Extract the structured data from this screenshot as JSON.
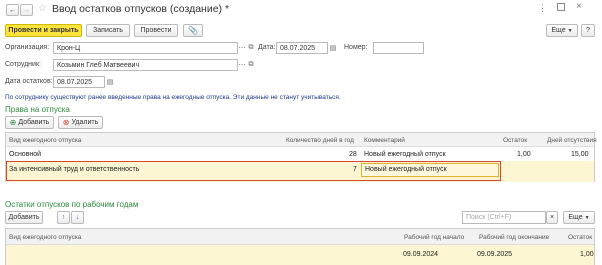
{
  "window": {
    "title": "Ввод остатков отпусков (создание) *",
    "more_icon": "more-icon",
    "maximize_icon": "maximize-icon",
    "close_icon": "close-icon"
  },
  "nav": {
    "back_icon": "arrow-left-icon",
    "forward_icon": "arrow-right-icon",
    "star_icon": "star-icon"
  },
  "toolbar": {
    "post_close": "Провести и закрыть",
    "save": "Записать",
    "post": "Провести",
    "attach_icon": "paperclip-icon",
    "more": "Еще",
    "help": "?"
  },
  "form": {
    "org_label": "Организация:",
    "org_value": "Крон-Ц",
    "date_label": "Дата:",
    "date_value": "08.07.2025",
    "number_label": "Номер:",
    "number_value": "",
    "employee_label": "Сотрудник:",
    "employee_value": "Козьмин Глеб Матвеевич",
    "balance_date_label": "Дата остатков:",
    "balance_date_value": "08.07.2025"
  },
  "notice": "По сотруднику существуют ранее введенные права на ежегодные отпуска. Эти данные не станут учитываться.",
  "rights": {
    "title": "Права на отпуска",
    "add": "Добавить",
    "delete": "Удалить",
    "columns": [
      "Вид ежегодного отпуска",
      "Количество дней в год",
      "Комментарий",
      "Остаток",
      "Дней отсутствия"
    ],
    "rows": [
      [
        "Основной",
        "28",
        "Новый ежегодный отпуск",
        "1,00",
        "15,00"
      ],
      [
        "За интенсивный труд и ответственность",
        "7",
        "Новый ежегодный отпуск",
        "",
        ""
      ]
    ]
  },
  "balances": {
    "title": "Остатки отпусков по рабочим годам",
    "add": "Добавить",
    "search_placeholder": "Поиск (Ctrl+F)",
    "more": "Еще",
    "columns": [
      "Вид ежегодного отпуска",
      "Рабочий год начало",
      "Рабочий год окончание",
      "Остаток"
    ],
    "rows": [
      [
        "",
        "09.09.2024",
        "09.09.2025",
        "1,00"
      ]
    ]
  },
  "colors": {
    "accent_yellow": "#fde43c",
    "row_highlight": "#fdf6d3",
    "selected_border": "#d9472b",
    "section_green": "#2e8b3d",
    "notice_blue": "#1d3a8a"
  }
}
